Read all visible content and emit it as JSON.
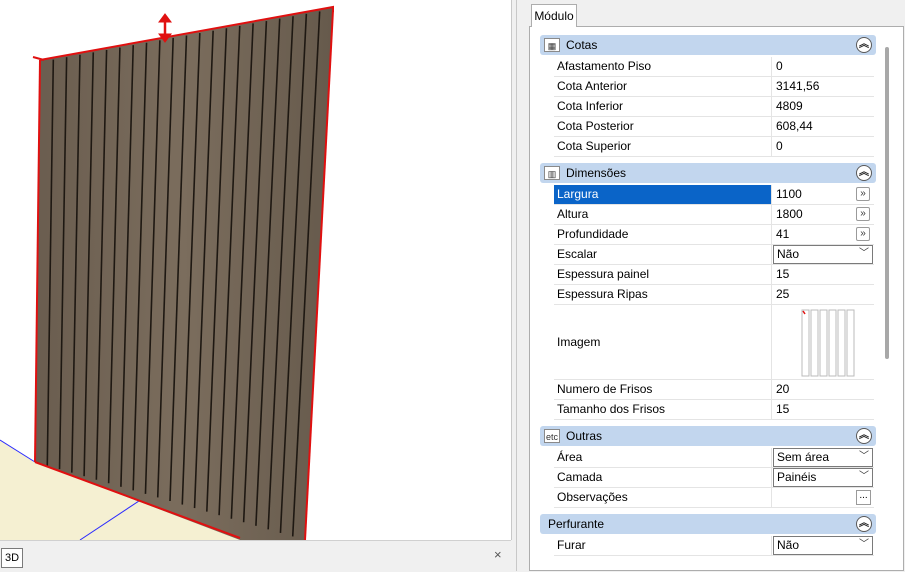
{
  "viewport": {
    "tab_label": "3D",
    "close_label": "×"
  },
  "panel": {
    "tab_label": "Módulo",
    "sections": {
      "cotas": {
        "title": "Cotas",
        "icon": "cotas-icon",
        "rows": [
          {
            "label": "Afastamento Piso",
            "value": "0"
          },
          {
            "label": "Cota Anterior",
            "value": "3141,56"
          },
          {
            "label": "Cota Inferior",
            "value": "4809"
          },
          {
            "label": "Cota Posterior",
            "value": "608,44"
          },
          {
            "label": "Cota Superior",
            "value": "0"
          }
        ]
      },
      "dimensoes": {
        "title": "Dimensões",
        "icon": "dimensoes-icon",
        "largura": {
          "label": "Largura",
          "value": "1100",
          "btn": "»"
        },
        "altura": {
          "label": "Altura",
          "value": "1800",
          "btn": "»"
        },
        "profundidade": {
          "label": "Profundidade",
          "value": "41",
          "btn": "»"
        },
        "escalar": {
          "label": "Escalar",
          "value": "Não"
        },
        "espessura_painel": {
          "label": "Espessura painel",
          "value": "15"
        },
        "espessura_ripas": {
          "label": "Espessura Ripas",
          "value": "25"
        },
        "imagem": {
          "label": "Imagem"
        },
        "numero_frisos": {
          "label": "Numero de Frisos",
          "value": "20"
        },
        "tamanho_frisos": {
          "label": "Tamanho dos Frisos",
          "value": "15"
        }
      },
      "outras": {
        "title": "Outras",
        "icon_text": "etc",
        "area": {
          "label": "Área",
          "value": "Sem área"
        },
        "camada": {
          "label": "Camada",
          "value": "Painéis"
        },
        "observacoes": {
          "label": "Observações",
          "btn": "..."
        }
      },
      "perfurante": {
        "title": "Perfurante",
        "furar": {
          "label": "Furar",
          "value": "Não"
        }
      }
    }
  },
  "colors": {
    "section_header": "#c2d6ee",
    "selection": "#0a64c8",
    "panel_wood": "#6e6152",
    "outline_red": "#e01010"
  }
}
